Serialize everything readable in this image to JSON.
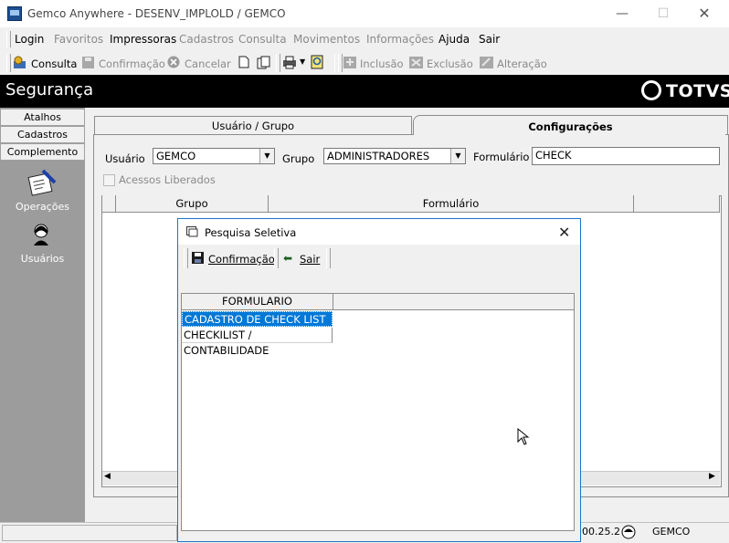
{
  "window": {
    "title": "Gemco Anywhere - DESENV_IMPLOLD / GEMCO",
    "minimize_glyph": "—",
    "maximize_glyph": "☐",
    "close_glyph": "✕"
  },
  "menu": {
    "items": [
      {
        "label": "Login",
        "enabled": true
      },
      {
        "label": "Favoritos",
        "enabled": false
      },
      {
        "label": "Impressoras",
        "enabled": true
      },
      {
        "label": "Cadastros",
        "enabled": false
      },
      {
        "label": "Consulta",
        "enabled": false
      },
      {
        "label": "Movimentos",
        "enabled": false
      },
      {
        "label": "Informações",
        "enabled": false
      },
      {
        "label": "Ajuda",
        "enabled": true
      },
      {
        "label": "Sair",
        "enabled": true
      }
    ]
  },
  "toolbar": {
    "consulta": "Consulta",
    "confirmacao": "Confirmação",
    "cancelar": "Cancelar",
    "inclusao": "Inclusão",
    "exclusao": "Exclusão",
    "alteracao": "Alteração"
  },
  "header": {
    "title": "Segurança",
    "logo": "TOTVS"
  },
  "left_panel": {
    "tabs": [
      "Atalhos",
      "Cadastros",
      "Complemento"
    ],
    "shortcuts": [
      {
        "label": "Operações",
        "icon": "operations-icon"
      },
      {
        "label": "Usuários",
        "icon": "users-icon"
      }
    ]
  },
  "tabs": {
    "usuario_grupo": "Usuário  / Grupo",
    "configuracoes": "Configurações"
  },
  "filters": {
    "usuario_label": "Usuário",
    "usuario_value": "GEMCO",
    "grupo_label": "Grupo",
    "grupo_value": "ADMINISTRADORES",
    "formulario_label": "Formulário",
    "formulario_value": "CHECK",
    "acessos_label": "Acessos Liberados"
  },
  "grid": {
    "columns": [
      "Grupo",
      "Formulário"
    ]
  },
  "statusbar": {
    "version": "00.25.2",
    "user": "GEMCO"
  },
  "dialog": {
    "title": "Pesquisa Seletiva",
    "confirm_label": "Confirmação",
    "exit_label": "Sair",
    "column_header": "FORMULARIO",
    "rows": [
      "CADASTRO DE CHECK LIST",
      "CHECKILIST / CONTABILIDADE"
    ]
  },
  "colors": {
    "header_bg": "#000000",
    "left_panel_bg": "#9c9c9c",
    "selection": "#0078d7",
    "dialog_border": "#1e73c6"
  }
}
